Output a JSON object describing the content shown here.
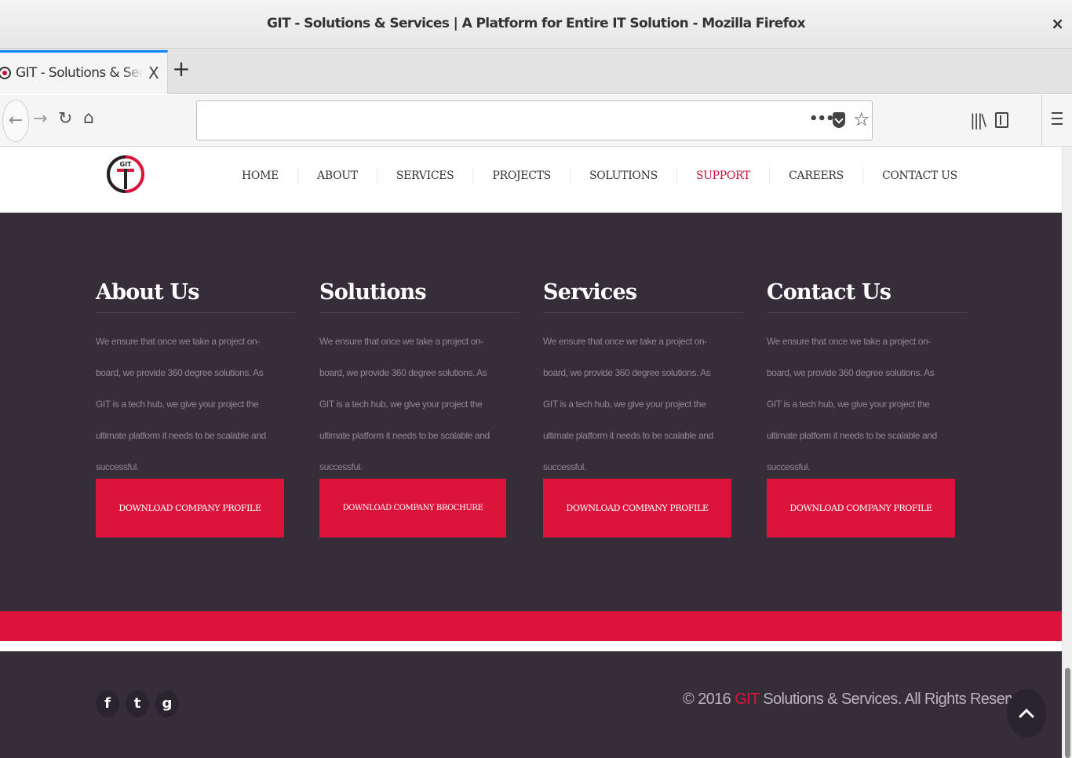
{
  "window": {
    "title": "GIT - Solutions & Services | A Platform for Entire IT Solution - Mozilla Firefox",
    "close_label": "×"
  },
  "tabs": [
    {
      "label": "GIT - Solutions & Services | A Platform for Entire IT Solution",
      "close_label": "X"
    }
  ],
  "new_tab_label": "+",
  "toolbar": {
    "url_value": "",
    "more_label": "•••",
    "icons": [
      "back-icon",
      "forward-icon",
      "reload-icon",
      "home-icon",
      "pocket-icon",
      "bookmark-star-icon",
      "library-icon",
      "sidebar-icon",
      "hamburger-menu-icon"
    ]
  },
  "site": {
    "logo_text": "GIT",
    "nav": [
      "HOME",
      "ABOUT",
      "SERVICES",
      "PROJECTS",
      "SOLUTIONS",
      "SUPPORT",
      "CAREERS",
      "CONTACT US"
    ],
    "active_nav": "SUPPORT",
    "columns": [
      {
        "heading": "About Us",
        "text": "We ensure that once we take a project on-board, we provide 360 degree solutions. As GIT is a tech hub, we give your project the ultimate platform it needs to be scalable and successful.",
        "button": "DOWNLOAD COMPANY PROFILE"
      },
      {
        "heading": "Solutions",
        "text": "We ensure that once we take a project on-board, we provide 360 degree solutions. As GIT is a tech hub, we give your project the ultimate platform it needs to be scalable and successful.",
        "button": "DOWNLOAD COMPANY BROCHURE"
      },
      {
        "heading": "Services",
        "text": "We ensure that once we take a project on-board, we provide 360 degree solutions. As GIT is a tech hub, we give your project the ultimate platform it needs to be scalable and successful.",
        "button": "DOWNLOAD COMPANY PROFILE"
      },
      {
        "heading": "Contact Us",
        "text": "We ensure that once we take a project on-board, we provide 360 degree solutions. As GIT is a tech hub, we give your project the ultimate platform it needs to be scalable and successful.",
        "button": "DOWNLOAD COMPANY PROFILE"
      }
    ],
    "social": [
      {
        "icon": "facebook-icon",
        "glyph": "f"
      },
      {
        "icon": "twitter-icon",
        "glyph": "t"
      },
      {
        "icon": "google-icon",
        "glyph": "g"
      }
    ],
    "copyright": {
      "prefix": "© 2016 ",
      "brand": "GIT",
      "suffix": " Solutions & Services. All Rights Reserved."
    },
    "colors": {
      "accent": "#dc143c",
      "footer_bg": "#352d38",
      "footer_text": "#8f8791"
    }
  }
}
